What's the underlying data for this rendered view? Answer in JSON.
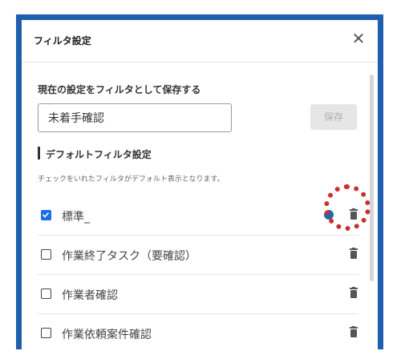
{
  "dialog": {
    "title": "フィルタ設定",
    "close_icon": "close-icon"
  },
  "save_section": {
    "label": "現在の設定をフィルタとして保存する",
    "input_value": "未着手確認",
    "save_button": "保存"
  },
  "default_section": {
    "title": "デフォルトフィルタ設定",
    "description": "チェックをいれたフィルタがデフォルト表示となります。"
  },
  "filters": [
    {
      "label": "標準_",
      "checked": true
    },
    {
      "label": "作業終了タスク（要確認）",
      "checked": false
    },
    {
      "label": "作業者確認",
      "checked": false
    },
    {
      "label": "作業依頼案件確認",
      "checked": false
    }
  ],
  "colors": {
    "frame": "#1f5fae",
    "checkbox_checked": "#1e6ee6",
    "highlight": "#c9302c"
  }
}
